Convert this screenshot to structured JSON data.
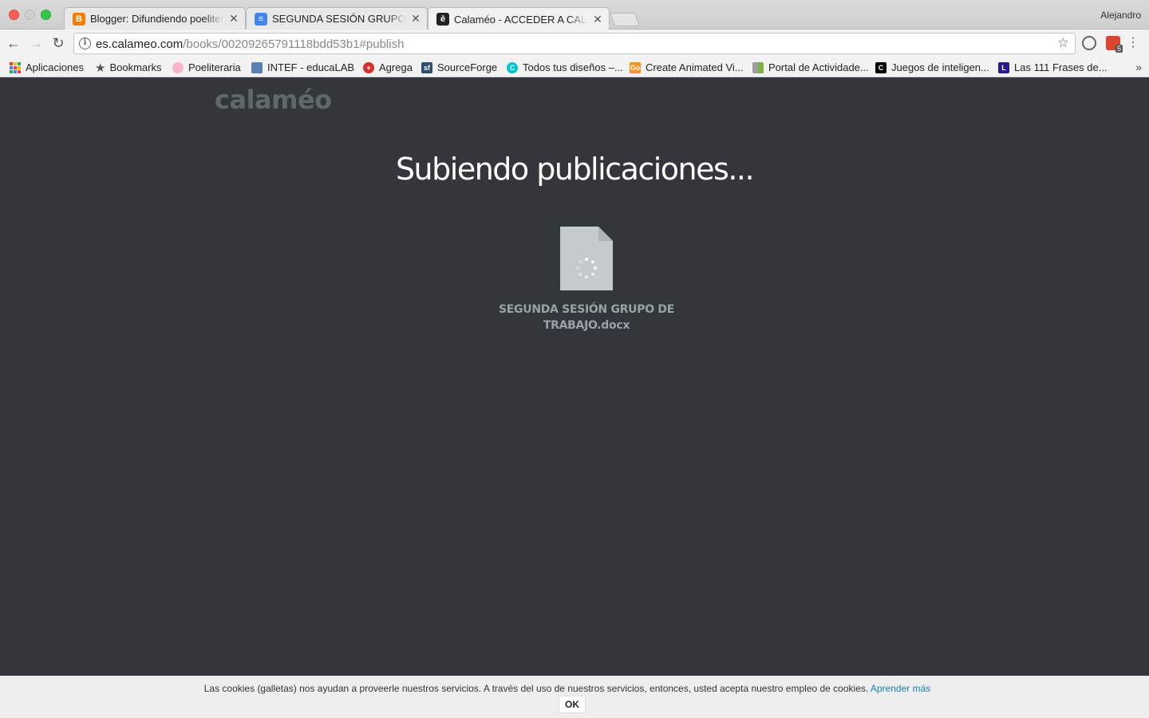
{
  "browser": {
    "tabs": [
      {
        "title": "Blogger: Difundiendo poeliteraria",
        "favicon": "blogger-icon",
        "color": "#f57d00"
      },
      {
        "title": "SEGUNDA SESIÓN GRUPO DE TRABAJO",
        "favicon": "docs-icon",
        "color": "#4285f4"
      },
      {
        "title": "Calaméo - ACCEDER A CALAMÉO",
        "favicon": "calameo-icon",
        "color": "#222222"
      }
    ],
    "profile_name": "Alejandro",
    "url_host": "es.calameo.com",
    "url_path": "/books/00209265791118bdd53b1#publish",
    "bookmarks": [
      {
        "label": "Aplicaciones",
        "icon": "apps-grid-icon"
      },
      {
        "label": "Bookmarks",
        "icon": "star-icon"
      },
      {
        "label": "Poeliteraria",
        "icon": "flower-icon"
      },
      {
        "label": "INTEF - educaLAB",
        "icon": "intef-icon"
      },
      {
        "label": "Agrega",
        "icon": "agrega-icon"
      },
      {
        "label": "SourceForge",
        "icon": "sourceforge-icon"
      },
      {
        "label": "Todos tus diseños –...",
        "icon": "canva-icon"
      },
      {
        "label": "Create Animated Vi...",
        "icon": "goanimate-icon"
      },
      {
        "label": "Portal de Actividade...",
        "icon": "portal-icon"
      },
      {
        "label": "Juegos de inteligen...",
        "icon": "juegos-icon"
      },
      {
        "label": "Las 111 Frases de...",
        "icon": "letter-l-icon"
      }
    ],
    "extension_badge": "5"
  },
  "page": {
    "logo": "calaméo",
    "heading": "Subiendo publicaciones...",
    "file_name_line1": "SEGUNDA SESIÓN GRUPO DE",
    "file_name_line2": "TRABAJO.docx"
  },
  "cookie_bar": {
    "text": "Las cookies (galletas) nos ayudan a proveerle nuestros servicios. A través del uso de nuestros servicios, entonces, usted acepta nuestro empleo de cookies. ",
    "link": "Aprender más",
    "ok_label": "OK"
  },
  "colors": {
    "page_background": "#33373c",
    "heading": "#ffffff",
    "file_name": "#9aa1a8",
    "link": "#1a7fc2"
  }
}
